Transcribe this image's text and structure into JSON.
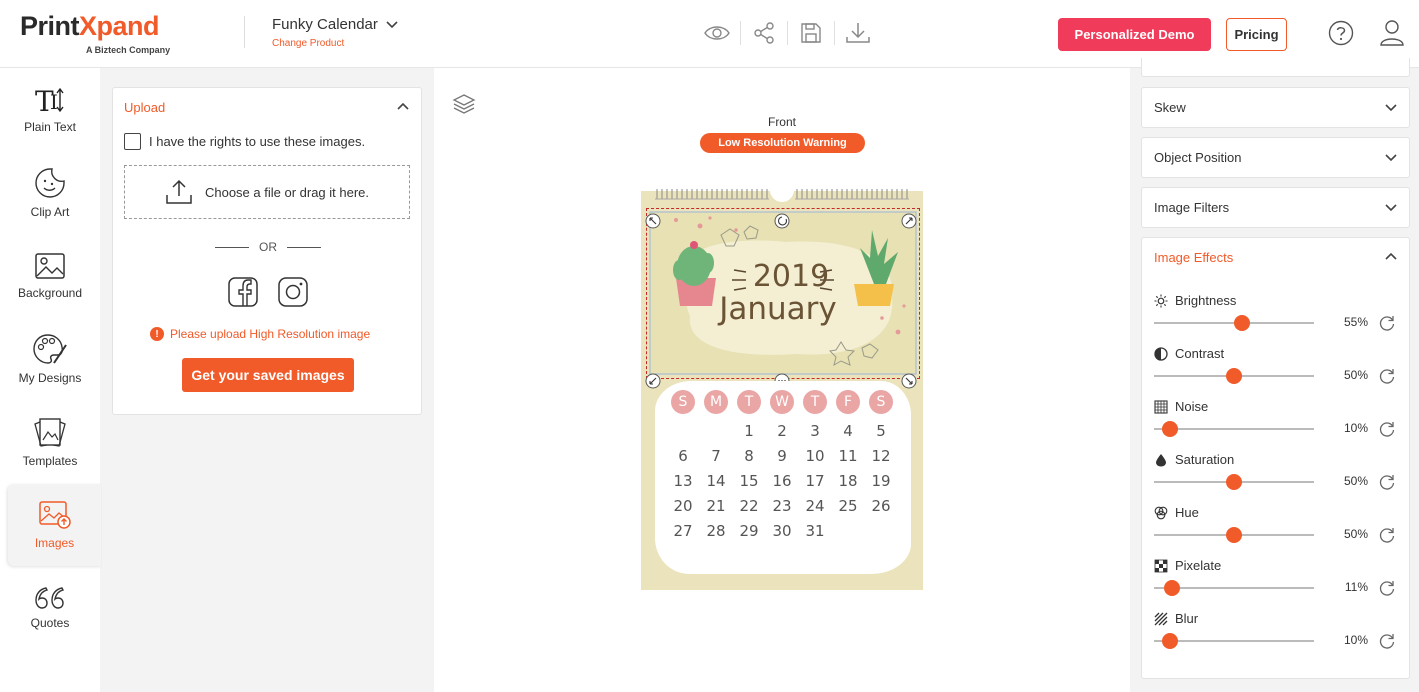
{
  "header": {
    "logo_main_dark": "Print",
    "logo_main_orange": "Xpand",
    "logo_sub": "A Biztech Company",
    "product_name": "Funky Calendar",
    "product_change": "Change Product",
    "tools": [
      "preview-eye-icon",
      "share-icon",
      "save-icon",
      "download-icon"
    ],
    "demo_label": "Personalized Demo",
    "pricing_label": "Pricing"
  },
  "sidebar": {
    "items": [
      {
        "label": "Plain Text",
        "icon": "text-icon"
      },
      {
        "label": "Clip Art",
        "icon": "clipart-icon"
      },
      {
        "label": "Background",
        "icon": "background-icon"
      },
      {
        "label": "My Designs",
        "icon": "palette-icon"
      },
      {
        "label": "Templates",
        "icon": "templates-icon"
      },
      {
        "label": "Images",
        "icon": "images-icon"
      },
      {
        "label": "Quotes",
        "icon": "quotes-icon"
      }
    ]
  },
  "upload": {
    "title": "Upload",
    "rights_label": "I have the rights to use these images.",
    "dropzone_label": "Choose a file or drag it here.",
    "or_label": "OR",
    "warning": "Please upload High Resolution image",
    "saved_button": "Get your saved images"
  },
  "canvas": {
    "side_label": "Front",
    "warning_badge": "Low Resolution Warning",
    "year": "2019",
    "month": "January",
    "weekdays": [
      "S",
      "M",
      "T",
      "W",
      "T",
      "F",
      "S"
    ],
    "weeks": [
      [
        "",
        "",
        "1",
        "2",
        "3",
        "4",
        "5"
      ],
      [
        "6",
        "7",
        "8",
        "9",
        "10",
        "11",
        "12"
      ],
      [
        "13",
        "14",
        "15",
        "16",
        "17",
        "18",
        "19"
      ],
      [
        "20",
        "21",
        "22",
        "23",
        "24",
        "25",
        "26"
      ],
      [
        "27",
        "28",
        "29",
        "30",
        "31",
        "",
        ""
      ]
    ]
  },
  "right_panel": {
    "sections": [
      "Skew",
      "Object Position",
      "Image Filters"
    ],
    "effects_title": "Image Effects",
    "effects": [
      {
        "name": "Brightness",
        "value": "55%",
        "level": 55,
        "icon": "brightness-icon"
      },
      {
        "name": "Contrast",
        "value": "50%",
        "level": 50,
        "icon": "contrast-icon"
      },
      {
        "name": "Noise",
        "value": "10%",
        "level": 10,
        "icon": "noise-icon"
      },
      {
        "name": "Saturation",
        "value": "50%",
        "level": 50,
        "icon": "saturation-icon"
      },
      {
        "name": "Hue",
        "value": "50%",
        "level": 50,
        "icon": "hue-icon"
      },
      {
        "name": "Pixelate",
        "value": "11%",
        "level": 11,
        "icon": "pixelate-icon"
      },
      {
        "name": "Blur",
        "value": "10%",
        "level": 10,
        "icon": "blur-icon"
      }
    ]
  },
  "colors": {
    "accent": "#f15a29",
    "demo_button": "#f03c5a",
    "calendar_bg": "#ebe3bb",
    "weekday_circle": "#eaa5a5"
  }
}
